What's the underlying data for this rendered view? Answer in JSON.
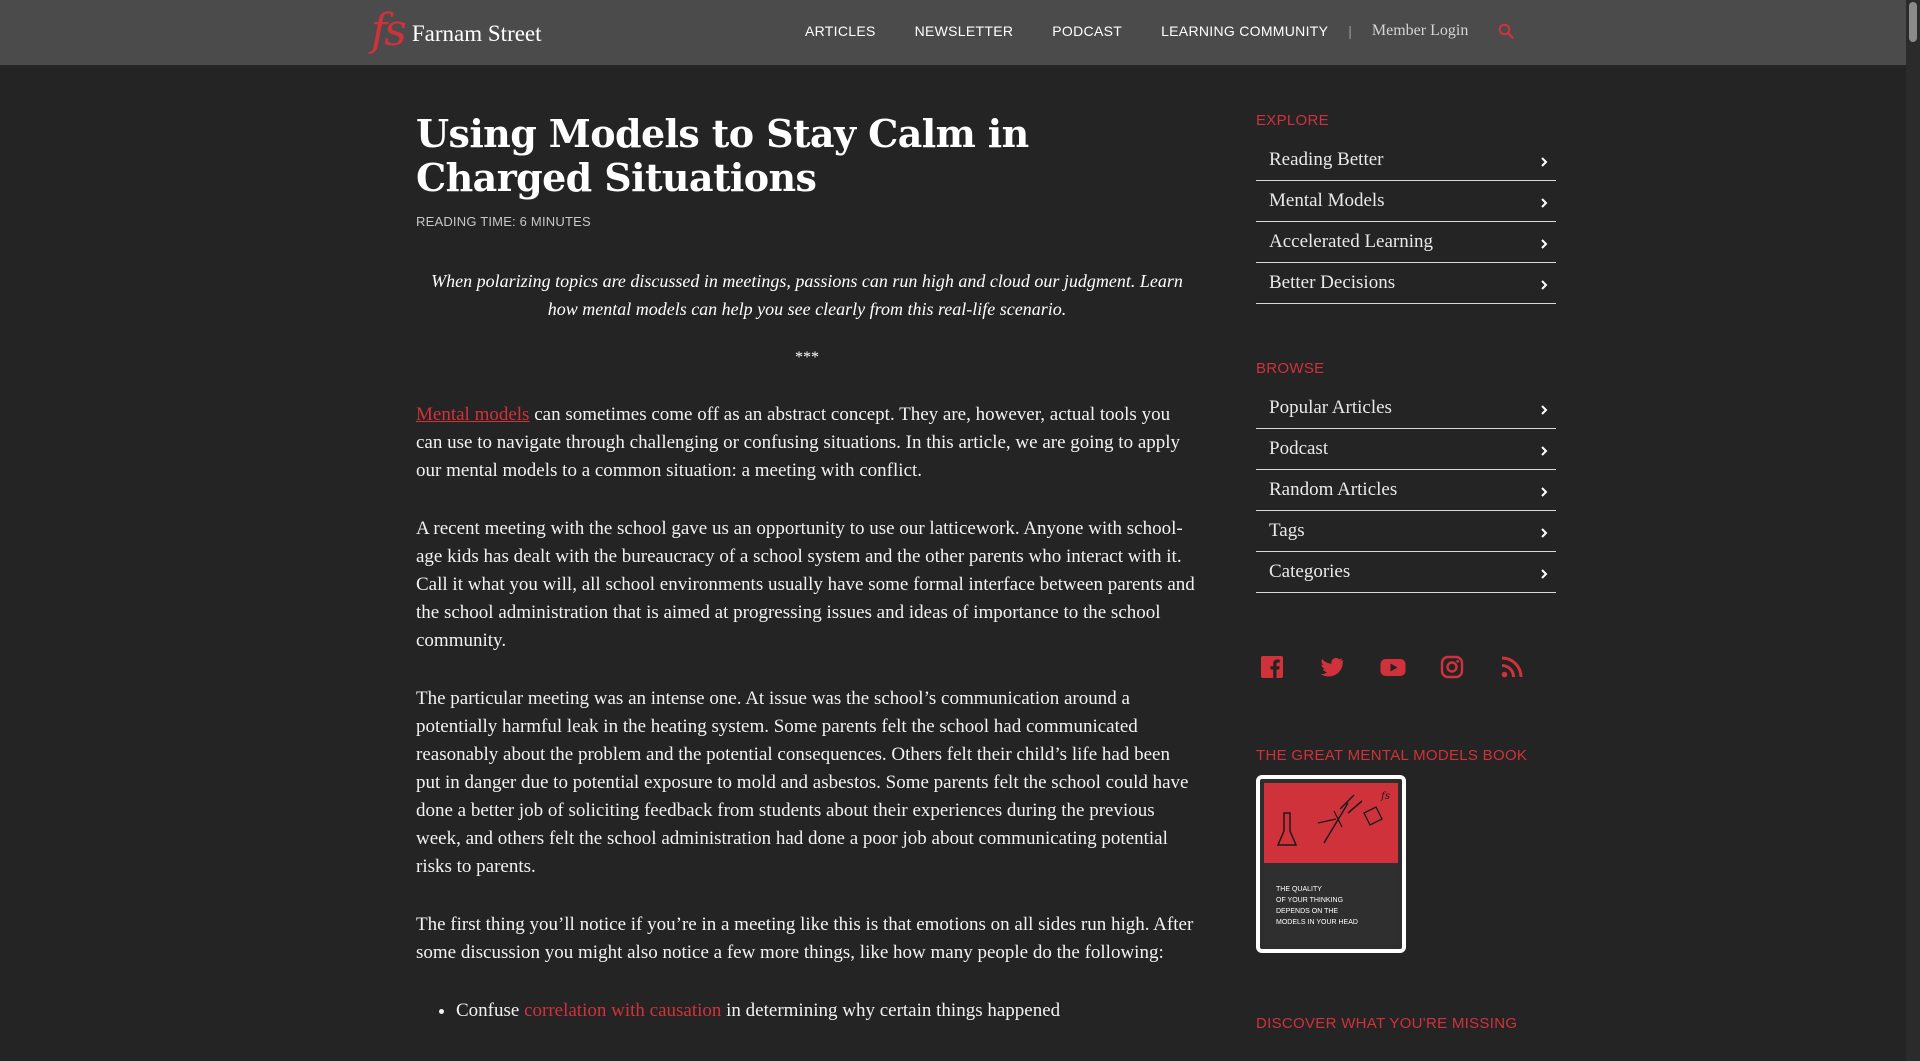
{
  "header": {
    "logo_mark": "fs",
    "logo_text": "Farnam Street",
    "nav": [
      "ARTICLES",
      "NEWSLETTER",
      "PODCAST",
      "LEARNING COMMUNITY"
    ],
    "separator": "|",
    "member_login": "Member Login",
    "search_icon": "search-icon"
  },
  "article": {
    "title": "Using Models to Stay Calm in Charged Situations",
    "reading_time": "READING TIME: 6 MINUTES",
    "intro": "When polarizing topics are discussed in meetings, passions can run high and cloud our judgment. Learn how mental models can help you see clearly from this real-life scenario.",
    "separator": "***",
    "p1_link": "Mental models",
    "p1_rest": " can sometimes come off as an abstract concept. They are, however, actual tools you can use to navigate through challenging or confusing situations. In this article, we are going to apply our mental models to a common situation: a meeting with conflict.",
    "p2": "A recent meeting with the school gave us an opportunity to use our latticework. Anyone with school-age kids has dealt with the bureaucracy of a school system and the other parents who interact with it. Call it what you will, all school environments usually have some formal interface between parents and the school administration that is aimed at progressing issues and ideas of importance to the school community.",
    "p3": "The particular meeting was an intense one. At issue was the school’s communication around a potentially harmful leak in the heating system. Some parents felt the school had communicated reasonably about the problem and the potential consequences. Others felt their child’s life had been put in danger due to potential exposure to mold and asbestos. Some parents felt the school could have done a better job of soliciting feedback from students about their experiences during the previous week, and others felt the school administration had done a poor job about communicating potential risks to parents.",
    "p4": "The first thing you’ll notice if you’re in a meeting like this is that emotions on all sides run high. After some discussion you might also notice a few more things, like how many people do the following:",
    "bullet1_pre": "Confuse ",
    "bullet1_link": "correlation with causation",
    "bullet1_post": " in determining why certain things happened"
  },
  "sidebar": {
    "explore_heading": "EXPLORE",
    "explore_items": [
      "Reading Better",
      "Mental Models",
      "Accelerated Learning",
      "Better Decisions"
    ],
    "browse_heading": "BROWSE",
    "browse_items": [
      "Popular Articles",
      "Podcast",
      "Random Articles",
      "Tags",
      "Categories"
    ],
    "social_icons": [
      "facebook-icon",
      "twitter-icon",
      "youtube-icon",
      "instagram-icon",
      "rss-icon"
    ],
    "book_heading": "THE GREAT MENTAL MODELS BOOK",
    "book_cover_text": "THE QUALITY OF YOUR THINKING DEPENDS ON THE MODELS IN YOUR HEAD",
    "discover_heading": "DISCOVER WHAT YOU'RE MISSING"
  },
  "colors": {
    "accent": "#d0323c",
    "header_bg": "#4b4b4b",
    "page_bg": "#242424",
    "text": "#f2f2f2"
  }
}
